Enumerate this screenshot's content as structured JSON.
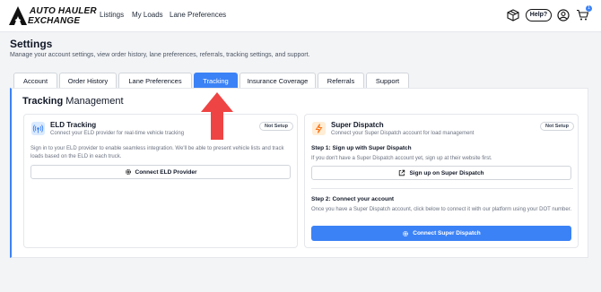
{
  "brand": {
    "line1": "AUTO HAULER",
    "line2": "EXCHANGE"
  },
  "nav": {
    "listings": "Listings",
    "my_loads": "My Loads",
    "lane_preferences": "Lane Preferences"
  },
  "header": {
    "help_label": "Help?",
    "cart_count": "1",
    "icons": [
      "package-icon",
      "avatar-icon",
      "cart-icon"
    ]
  },
  "settings": {
    "title": "Settings",
    "subtitle": "Manage your account settings, view order history, lane preferences, referrals, tracking settings, and support."
  },
  "tabs": [
    {
      "label": "Account",
      "active": false
    },
    {
      "label": "Order History",
      "active": false
    },
    {
      "label": "Lane Preferences",
      "active": false
    },
    {
      "label": "Tracking",
      "active": true
    },
    {
      "label": "Insurance Coverage",
      "active": false
    },
    {
      "label": "Referrals",
      "active": false
    },
    {
      "label": "Support",
      "active": false
    }
  ],
  "tracking": {
    "title_bold": "Tracking",
    "title_rest": " Management",
    "eld": {
      "title": "ELD Tracking",
      "subtitle": "Connect your ELD provider for real-time vehicle tracking",
      "badge": "Not Setup",
      "description": "Sign in to your ELD provider to enable seamless integration. We'll be able to present vehicle lists and track loads based on the ELD in each truck.",
      "button": "Connect ELD Provider"
    },
    "super_dispatch": {
      "title": "Super Dispatch",
      "subtitle": "Connect your Super Dispatch account for load management",
      "badge": "Not Setup",
      "step1_title": "Step 1: Sign up with Super Dispatch",
      "step1_desc": "If you don't have a Super Dispatch account yet, sign up at their website first.",
      "step1_button": "Sign up on Super Dispatch",
      "step2_title": "Step 2: Connect your account",
      "step2_desc": "Once you have a Super Dispatch account, click below to connect it with our platform using your DOT number.",
      "step2_button": "Connect Super Dispatch"
    }
  },
  "colors": {
    "accent": "#3b82f6",
    "arrow": "#ef4444",
    "eld_icon_bg": "#dbeafe",
    "sd_icon_bg": "#ffedd5"
  }
}
